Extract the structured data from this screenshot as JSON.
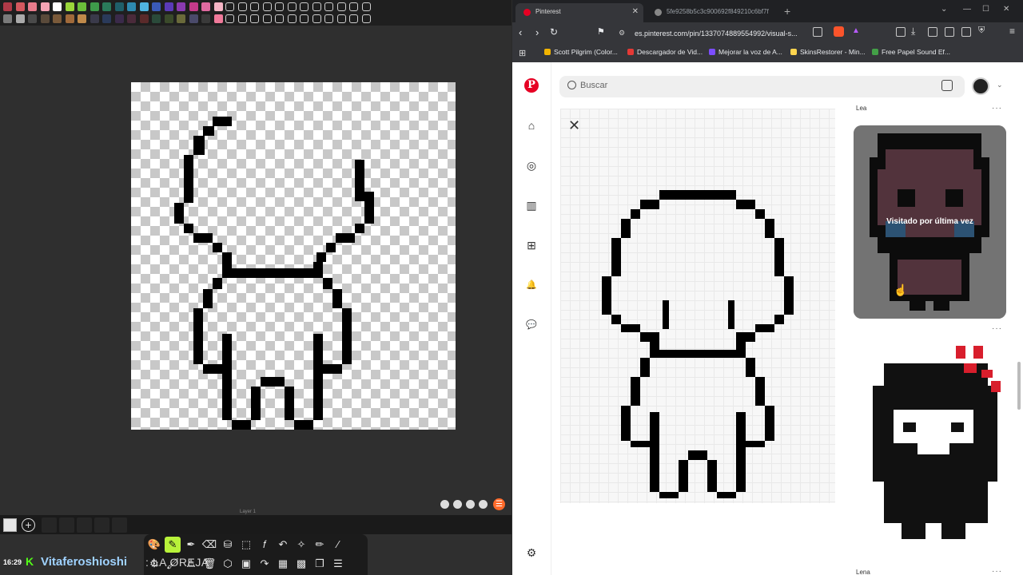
{
  "editor": {
    "layer_label": "Layer 1",
    "palette_colors": [
      "#b03a48",
      "#d4585e",
      "#e87c8c",
      "#f5a4b4",
      "#ffffff",
      "#9ad63a",
      "#6bbf3a",
      "#3e9a4a",
      "#2a7a5a",
      "#1f5f6a",
      "#2e8ab0",
      "#4fb4e0",
      "#3a5ab8",
      "#5a3ab8",
      "#8a3ab0",
      "#c43a8a",
      "#e06aa0",
      "#f5b5c5",
      "#7a7a7a",
      "#aaaaaa",
      "#4a4a4a",
      "#5a4a3a",
      "#7a5a3a",
      "#a06a3a",
      "#c08a4a",
      "#3a3a4a",
      "#2a3a5a",
      "#3a2a4a",
      "#4a2a3a",
      "#5a2a2a",
      "#2a4a3a",
      "#3a4a2a",
      "#6a6a3a",
      "#4a4a6a",
      "#3a3a3a",
      "#f07a9a"
    ],
    "empty_slots": 24,
    "mini_tools": [
      "eye-icon",
      "settings-icon",
      "undo-icon",
      "redo-icon"
    ],
    "tools": [
      {
        "name": "palette",
        "glyph": "🎨"
      },
      {
        "name": "pencil",
        "glyph": "✎"
      },
      {
        "name": "pen",
        "glyph": "✒"
      },
      {
        "name": "eraser",
        "glyph": "⌫"
      },
      {
        "name": "bucket",
        "glyph": "⛁"
      },
      {
        "name": "select",
        "glyph": "⬚"
      },
      {
        "name": "function",
        "glyph": "𝑓"
      },
      {
        "name": "undo",
        "glyph": "↶"
      },
      {
        "name": "wand",
        "glyph": "✧"
      },
      {
        "name": "brush",
        "glyph": "✏"
      },
      {
        "name": "eyedropper",
        "glyph": "⁄"
      },
      {
        "name": "settings",
        "glyph": "⚙"
      },
      {
        "name": "paint",
        "glyph": "🖌"
      },
      {
        "name": "warning",
        "glyph": "⚠"
      },
      {
        "name": "trash",
        "glyph": "🗑"
      },
      {
        "name": "hexagon",
        "glyph": "⬡"
      },
      {
        "name": "image",
        "glyph": "▣"
      },
      {
        "name": "redo",
        "glyph": "↷"
      },
      {
        "name": "filter",
        "glyph": "▦"
      },
      {
        "name": "grid",
        "glyph": "▩"
      },
      {
        "name": "layers",
        "glyph": "❐"
      },
      {
        "name": "menu",
        "glyph": "☰"
      }
    ]
  },
  "chat": {
    "time": "16:29",
    "badge": "K",
    "user": "Vitaferoshioshi",
    "message": ": LA OREJA"
  },
  "browser": {
    "tabs": [
      {
        "title": "Pinterest",
        "active": true
      },
      {
        "title": "5fe9258b5c3c900692f849210c6bf7f",
        "active": false
      }
    ],
    "url": "es.pinterest.com/pin/1337074889554992/visual-s...",
    "bookmarks": [
      {
        "label": "Scott Pilgrim (Color...",
        "color": "#f2b400"
      },
      {
        "label": "Descargador de Vid...",
        "color": "#e53935"
      },
      {
        "label": "Mejorar la voz de A...",
        "color": "#7c4dff"
      },
      {
        "label": "SkinsRestorer - Min...",
        "color": "#ffd54f"
      },
      {
        "label": "Free Papel Sound Ef...",
        "color": "#43a047"
      }
    ]
  },
  "pinterest": {
    "logo": "P",
    "search_placeholder": "Buscar",
    "close_glyph": "✕",
    "sidebar": [
      {
        "name": "home",
        "glyph": "⌂"
      },
      {
        "name": "explore",
        "glyph": "◎"
      },
      {
        "name": "boards",
        "glyph": "▥"
      },
      {
        "name": "create",
        "glyph": "⊞"
      },
      {
        "name": "notifications",
        "glyph": "🔔"
      },
      {
        "name": "messages",
        "glyph": "💬"
      }
    ],
    "settings_glyph": "⚙",
    "card_top_author": "Lea",
    "card1_overlay": "Visitado por última vez",
    "card_bottom_author": "Lena",
    "more_glyph": "···"
  }
}
